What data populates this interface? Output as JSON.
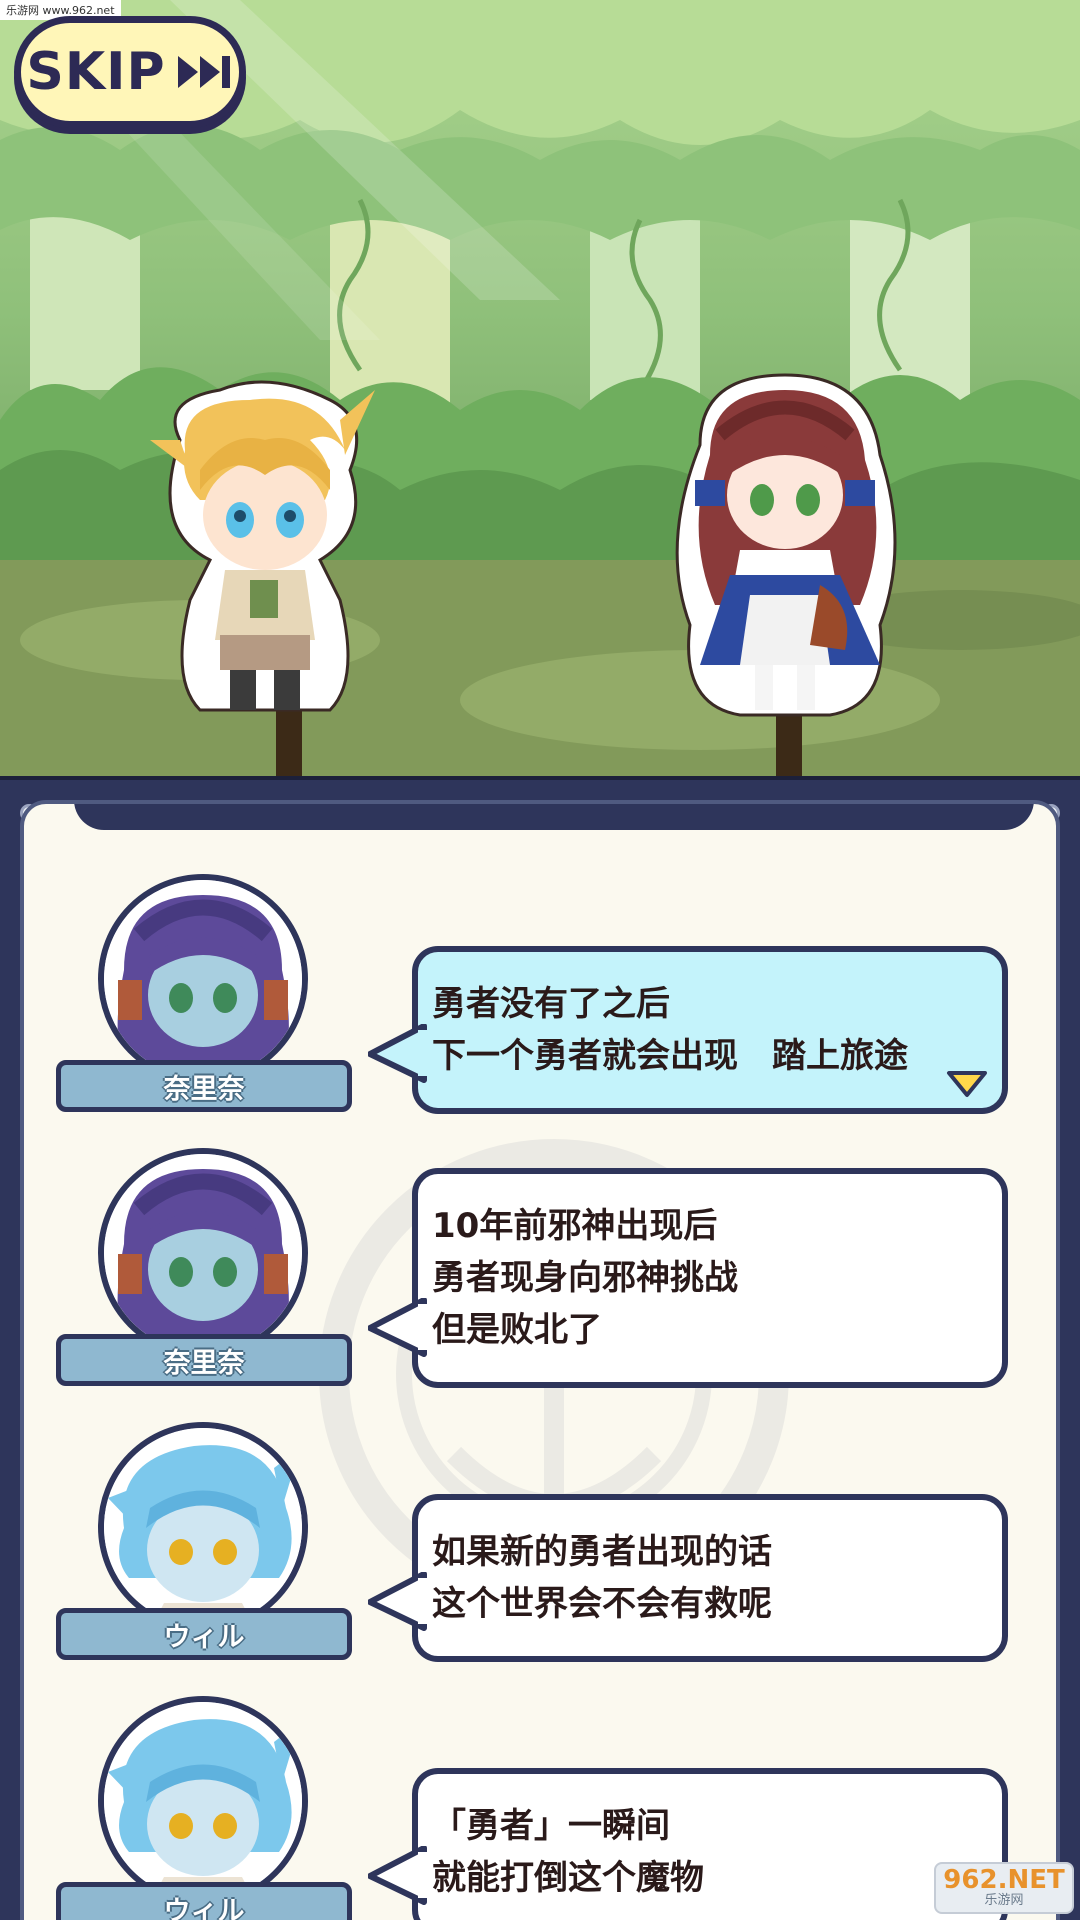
{
  "watermark_top": "乐游网 www.962.net",
  "skip_button": {
    "label": "SKIP",
    "icon": "fast-forward-icon"
  },
  "scene": {
    "characters": [
      {
        "name": "ウィル",
        "role": "blonde-boy"
      },
      {
        "name": "奈里奈",
        "role": "brown-haired-girl"
      }
    ]
  },
  "dialog": [
    {
      "speaker": "奈里奈",
      "portrait": "purple-haired-girl",
      "text": "勇者没有了之后\n下一个勇者就会出现　踏上旅途",
      "active": true
    },
    {
      "speaker": "奈里奈",
      "portrait": "purple-haired-girl",
      "text": "10年前邪神出现后\n勇者现身向邪神挑战\n但是败北了",
      "active": false
    },
    {
      "speaker": "ウィル",
      "portrait": "blue-haired-boy",
      "text": "如果新的勇者出现的话\n这个世界会不会有救呢",
      "active": false
    },
    {
      "speaker": "ウィル",
      "portrait": "blue-haired-boy",
      "text": "「勇者」一瞬间\n就能打倒这个魔物",
      "active": false
    }
  ],
  "watermark_bottom": {
    "line1": "962.NET",
    "line2": "乐游网"
  },
  "colors": {
    "panel_frame": "#2e355b",
    "active_bubble": "#c4f3fb",
    "nameplate": "#8fb8d0",
    "skip_fill": "#fff6b8"
  }
}
